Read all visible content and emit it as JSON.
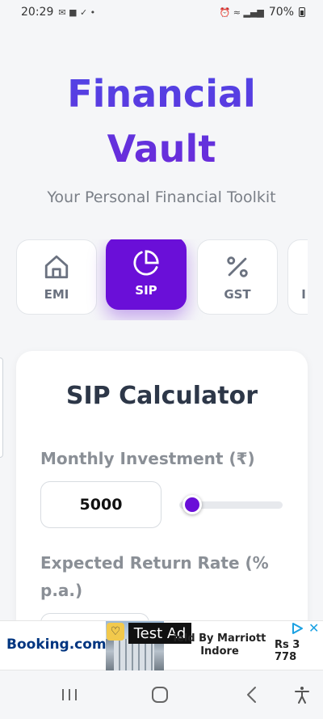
{
  "status_bar": {
    "time": "20:29",
    "battery": "70%"
  },
  "header": {
    "title": "Financial Vault",
    "subtitle": "Your Personal Financial Toolkit"
  },
  "tabs": [
    {
      "label": "EMI",
      "icon": "home-icon",
      "active": false
    },
    {
      "label": "SIP",
      "icon": "pie-chart-icon",
      "active": true
    },
    {
      "label": "GST",
      "icon": "percent-icon",
      "active": false
    },
    {
      "label": "I",
      "icon": "partial-icon",
      "active": false
    }
  ],
  "calculator": {
    "title": "SIP Calculator",
    "monthly_label": "Monthly Investment (₹)",
    "monthly_value": "5000",
    "slider_fraction": 0.03,
    "rate_label": "Expected Return Rate (% p.a.)"
  },
  "ad": {
    "brand": "Booking.com",
    "tag": "Test Ad",
    "hotel": "ield By Marriott Indore",
    "price": "Rs 3 778"
  },
  "colors": {
    "accent": "#6a0fd8",
    "title_start": "#4f46e5",
    "title_end": "#6d28d9",
    "booking_blue": "#003580"
  }
}
